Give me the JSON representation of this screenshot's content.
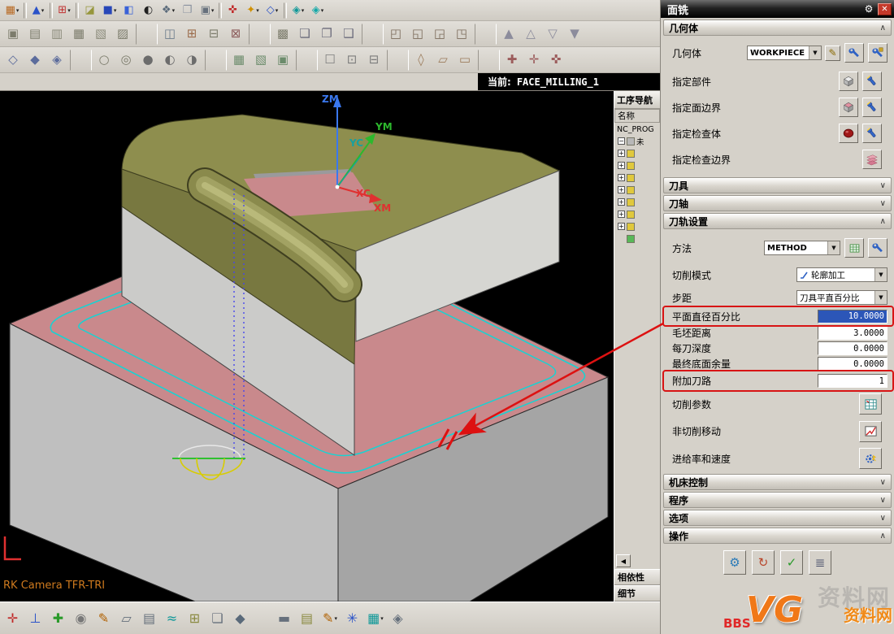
{
  "window": {
    "status_label": "当前:",
    "status_value": "FACE_MILLING_1"
  },
  "toolbars": {
    "row1": [
      {
        "g": "▦",
        "c": "#b86820",
        "dd": "▾"
      },
      {
        "t": "sep"
      },
      {
        "g": "▲",
        "c": "#2a52c8",
        "dd": "▾"
      },
      {
        "t": "sep"
      },
      {
        "g": "⊞",
        "c": "#c03030",
        "dd": "▾"
      },
      {
        "t": "sep"
      },
      {
        "g": "◪",
        "c": "#96963c"
      },
      {
        "g": "■",
        "c": "#2847b8",
        "dd": "▾"
      },
      {
        "g": "◧",
        "c": "#3a62d8"
      },
      {
        "g": "◐",
        "c": "#202020"
      },
      {
        "g": "❖",
        "c": "#5a6a7a",
        "dd": "▾"
      },
      {
        "g": "❐",
        "c": "#8a92a0"
      },
      {
        "g": "▣",
        "c": "#66707c",
        "dd": "▾"
      },
      {
        "t": "sep"
      },
      {
        "g": "✜",
        "c": "#c02828"
      },
      {
        "g": "✦",
        "c": "#d09000",
        "dd": "▾"
      },
      {
        "g": "◇",
        "c": "#2a52c8",
        "dd": "▾"
      },
      {
        "t": "sep"
      },
      {
        "g": "◈",
        "c": "#0e9898",
        "dd": "▾"
      },
      {
        "g": "◈",
        "c": "#12a8a8",
        "dd": "▾"
      }
    ],
    "row2": [
      {
        "g": "▣",
        "c": "#7c7c6c"
      },
      {
        "g": "▤",
        "c": "#7c7c6c"
      },
      {
        "g": "▥",
        "c": "#8c8c7c"
      },
      {
        "g": "▦",
        "c": "#7c7c6c"
      },
      {
        "g": "▧",
        "c": "#8c8c7c"
      },
      {
        "g": "▨",
        "c": "#7c7c6c"
      },
      {
        "t": "sep"
      },
      {
        "g": "◫",
        "c": "#6c7c8c"
      },
      {
        "g": "⊞",
        "c": "#9c6c4c"
      },
      {
        "g": "⊟",
        "c": "#7c7c6c"
      },
      {
        "g": "⊠",
        "c": "#8c5c5c"
      },
      {
        "t": "sep"
      },
      {
        "g": "▩",
        "c": "#7c7c6c"
      },
      {
        "g": "❏",
        "c": "#6c6c7c"
      },
      {
        "g": "❐",
        "c": "#6c6c7c"
      },
      {
        "g": "❑",
        "c": "#6c6c7c"
      },
      {
        "t": "sep"
      },
      {
        "g": "◰",
        "c": "#7c6c5c"
      },
      {
        "g": "◱",
        "c": "#7c6c5c"
      },
      {
        "g": "◲",
        "c": "#7c6c5c"
      },
      {
        "g": "◳",
        "c": "#7c6c5c"
      },
      {
        "t": "sep"
      },
      {
        "g": "▲",
        "c": "#8c8c9c"
      },
      {
        "g": "△",
        "c": "#8c8c9c"
      },
      {
        "g": "▽",
        "c": "#8c8c9c"
      },
      {
        "g": "▼",
        "c": "#8c8c9c"
      }
    ],
    "row3": [
      {
        "g": "◇",
        "c": "#5c6c9c"
      },
      {
        "g": "◆",
        "c": "#5c6c9c"
      },
      {
        "g": "◈",
        "c": "#5c6c9c"
      },
      {
        "t": "sep"
      },
      {
        "g": "○",
        "c": "#7c7c6c"
      },
      {
        "g": "◎",
        "c": "#7c7c6c"
      },
      {
        "g": "●",
        "c": "#6c6c6c"
      },
      {
        "g": "◐",
        "c": "#6c6c6c"
      },
      {
        "g": "◑",
        "c": "#6c6c6c"
      },
      {
        "t": "sep"
      },
      {
        "g": "▦",
        "c": "#6c8c6c"
      },
      {
        "g": "▧",
        "c": "#6c8c6c"
      },
      {
        "g": "▣",
        "c": "#6c8c6c"
      },
      {
        "t": "sep"
      },
      {
        "g": "☐",
        "c": "#7c7c7c"
      },
      {
        "g": "⊡",
        "c": "#7c7c7c"
      },
      {
        "g": "⊟",
        "c": "#7c7c7c"
      },
      {
        "t": "sep"
      },
      {
        "g": "◊",
        "c": "#9c7c5c"
      },
      {
        "g": "▱",
        "c": "#9c7c5c"
      },
      {
        "g": "▭",
        "c": "#9c7c5c"
      },
      {
        "t": "sep"
      },
      {
        "g": "✚",
        "c": "#9c5c5c"
      },
      {
        "g": "✛",
        "c": "#9c5c5c"
      },
      {
        "g": "✜",
        "c": "#9c5c5c"
      }
    ],
    "bottom1": [
      {
        "g": "✛",
        "c": "#c02828"
      },
      {
        "g": "⊥",
        "c": "#2a52c8"
      },
      {
        "g": "✚",
        "c": "#2a9a2a"
      },
      {
        "g": "◉",
        "c": "#787878"
      },
      {
        "g": "✎",
        "c": "#b06000"
      },
      {
        "g": "▱",
        "c": "#66707c"
      },
      {
        "g": "▤",
        "c": "#66707c"
      },
      {
        "g": "≈",
        "c": "#0e9898"
      },
      {
        "g": "⊞",
        "c": "#8a8a40"
      },
      {
        "g": "❏",
        "c": "#66707c"
      },
      {
        "g": "◆",
        "c": "#5a6a7a"
      }
    ],
    "bottom2": [
      {
        "g": "▬",
        "c": "#66707c"
      },
      {
        "g": "▤",
        "c": "#8a8a40"
      },
      {
        "g": "✎",
        "c": "#b06000",
        "dd": "▾"
      },
      {
        "g": "✳",
        "c": "#2a52c8"
      },
      {
        "g": "▦",
        "c": "#0e9898",
        "dd": "▾"
      },
      {
        "g": "◈",
        "c": "#66707c"
      }
    ]
  },
  "navigator": {
    "title": "工序导航",
    "name_header": "名称",
    "root": "NC_PROG",
    "rows": [
      {
        "exp": "−",
        "icon": "#b8b8b8",
        "label": "未"
      },
      {
        "exp": "+",
        "icon": "#e0c83c",
        "label": ""
      },
      {
        "exp": "+",
        "icon": "#e0c83c",
        "label": ""
      },
      {
        "exp": "+",
        "icon": "#e0c83c",
        "label": ""
      },
      {
        "exp": "+",
        "icon": "#e0c83c",
        "label": ""
      },
      {
        "exp": "+",
        "icon": "#e0c83c",
        "label": ""
      },
      {
        "exp": "+",
        "icon": "#e0c83c",
        "label": ""
      },
      {
        "exp": "+",
        "icon": "#e0c83c",
        "label": ""
      },
      {
        "exp": "",
        "icon": "#58b858",
        "label": ""
      }
    ],
    "collapse_button": "◀",
    "tabs": [
      "相依性",
      "细节"
    ]
  },
  "viewport": {
    "axes": {
      "zm": "ZM",
      "ym": "YM",
      "yc": "YC",
      "xc": "XC",
      "xm": "XM"
    },
    "camera_label": "RK Camera TFR-TRI"
  },
  "dialog": {
    "title": "面铣",
    "geometry": {
      "header": "几何体",
      "geometry_label": "几何体",
      "geometry_value": "WORKPIECE",
      "specify_part": "指定部件",
      "specify_face_boundary": "指定面边界",
      "specify_check_body": "指定检查体",
      "specify_check_boundary": "指定检查边界"
    },
    "tool": {
      "header": "刀具"
    },
    "axis": {
      "header": "刀轴"
    },
    "path_settings": {
      "header": "刀轨设置",
      "method_label": "方法",
      "method_value": "METHOD",
      "cut_mode_label": "切削模式",
      "cut_mode_value": "轮廓加工",
      "stepover_label": "步距",
      "stepover_value": "刀具平直百分比",
      "flat_diameter_label": "平面直径百分比",
      "flat_diameter_value": "10.0000",
      "blank_distance_label": "毛坯距离",
      "blank_distance_value": "3.0000",
      "depth_label": "每刀深度",
      "depth_value": "0.0000",
      "floor_stock_label": "最终底面余量",
      "floor_stock_value": "0.0000",
      "extra_passes_label": "附加刀路",
      "extra_passes_value": "1",
      "cutting_params": "切削参数",
      "non_cutting": "非切削移动",
      "feeds": "进给率和速度"
    },
    "machine_control": {
      "header": "机床控制"
    },
    "program": {
      "header": "程序"
    },
    "options": {
      "header": "选项"
    },
    "actions": {
      "header": "操作",
      "buttons": [
        {
          "name": "generate-toolpath",
          "g": "⚙",
          "c": "#2a7ab8"
        },
        {
          "name": "replay-toolpath",
          "g": "↻",
          "c": "#b8452a"
        },
        {
          "name": "verify-toolpath",
          "g": "✓",
          "c": "#2a9a2a"
        },
        {
          "name": "list-toolpath",
          "g": "≣",
          "c": "#444a66"
        }
      ]
    }
  },
  "watermark": {
    "bbs": "BBS",
    "logo": "VG",
    "site": "资料网"
  }
}
